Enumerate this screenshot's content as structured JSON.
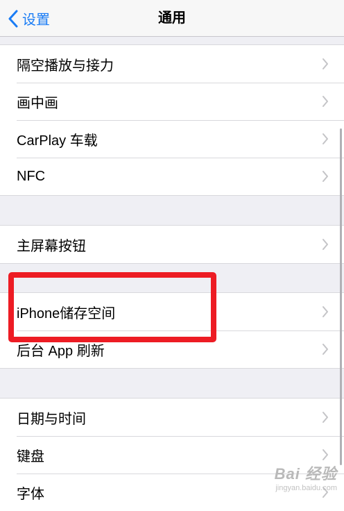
{
  "navbar": {
    "back_label": "设置",
    "title": "通用"
  },
  "groups": [
    {
      "items": [
        "隔空播放与接力",
        "画中画",
        "CarPlay 车载",
        "NFC"
      ]
    },
    {
      "items": [
        "主屏幕按钮"
      ]
    },
    {
      "items": [
        "iPhone储存空间",
        "后台 App 刷新"
      ]
    },
    {
      "items": [
        "日期与时间",
        "键盘",
        "字体"
      ]
    }
  ],
  "watermark": {
    "text": "Bai 经验",
    "sub": "jingyan.baidu.com"
  },
  "colors": {
    "accent": "#1a7cf5",
    "highlight": "#ed1c24",
    "background": "#efeff4"
  }
}
